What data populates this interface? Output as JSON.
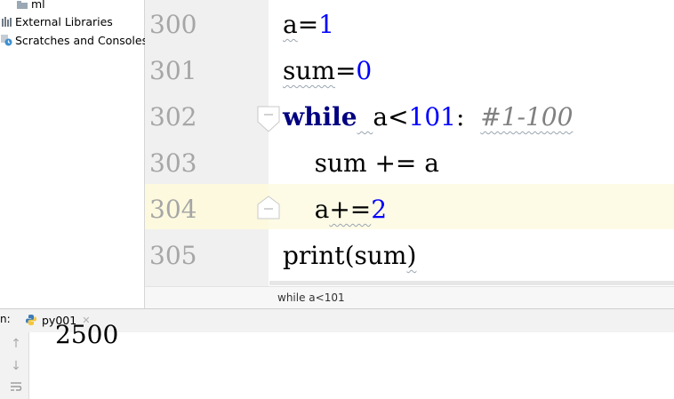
{
  "project_tree": {
    "items": [
      {
        "label": "ml",
        "icon": "folder-icon"
      },
      {
        "label": "External Libraries",
        "icon": "libraries-icon"
      },
      {
        "label": "Scratches and Consoles",
        "icon": "scratches-icon"
      }
    ]
  },
  "editor": {
    "line_numbers": [
      "300",
      "301",
      "302",
      "303",
      "304",
      "305"
    ],
    "lines": {
      "l300": {
        "var": "a",
        "op": "=",
        "num": "1"
      },
      "l301": {
        "var": "sum",
        "op": "=",
        "num": "0"
      },
      "l302": {
        "kw": "while",
        "var": "a",
        "op": "<",
        "num": "101",
        "colon": ":",
        "comment": "#1-100"
      },
      "l303": {
        "text": "sum += a"
      },
      "l304": {
        "var": "a",
        "op": "+=",
        "num": "2"
      },
      "l305": {
        "fn": "print",
        "lp": "(",
        "arg": "sum",
        "rp": ")"
      }
    },
    "breadcrumb": "while a<101",
    "current_line": "304"
  },
  "run": {
    "label": "n:",
    "tab_label": "py001",
    "tab_icon": "python-icon",
    "output": "2500"
  },
  "colors": {
    "keyword": "#000080",
    "number": "#0000ff",
    "comment": "#808080",
    "line_number": "#a6a6a6",
    "caret_line": "#fdfbe6"
  }
}
